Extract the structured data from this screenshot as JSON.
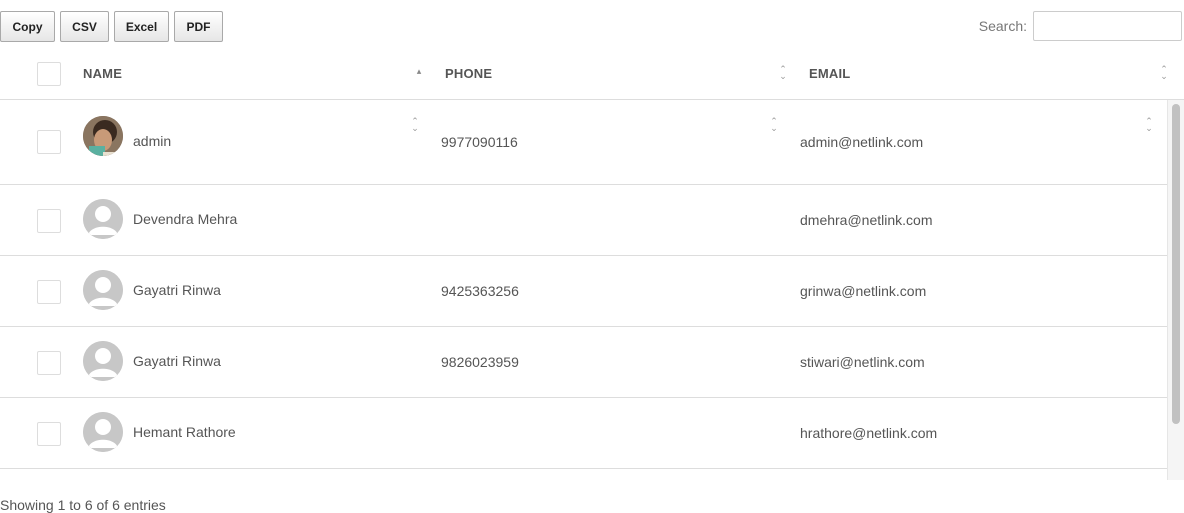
{
  "toolbar": {
    "buttons": [
      {
        "label": "Copy"
      },
      {
        "label": "CSV"
      },
      {
        "label": "Excel"
      },
      {
        "label": "PDF"
      }
    ]
  },
  "search": {
    "label": "Search:",
    "value": "",
    "placeholder": ""
  },
  "table": {
    "columns": [
      {
        "label": "NAME",
        "sort": "ascending"
      },
      {
        "label": "PHONE",
        "sort": "none"
      },
      {
        "label": "EMAIL",
        "sort": "none"
      }
    ],
    "rows": [
      {
        "name": "admin",
        "phone": "9977090116",
        "email": "admin@netlink.com",
        "avatar": "photo"
      },
      {
        "name": "Devendra Mehra",
        "phone": "",
        "email": "dmehra@netlink.com",
        "avatar": "default-user-icon"
      },
      {
        "name": "Gayatri Rinwa",
        "phone": "9425363256",
        "email": "grinwa@netlink.com",
        "avatar": "default-user-icon"
      },
      {
        "name": "Gayatri Rinwa",
        "phone": "9826023959",
        "email": "stiwari@netlink.com",
        "avatar": "default-user-icon"
      },
      {
        "name": "Hemant Rathore",
        "phone": "",
        "email": "hrathore@netlink.com",
        "avatar": "default-user-icon"
      }
    ]
  },
  "footer": {
    "info": "Showing 1 to 6 of 6 entries"
  },
  "colors": {
    "border": "#dddddd",
    "text": "#555555",
    "avatar_default": "#c7c7c7"
  }
}
